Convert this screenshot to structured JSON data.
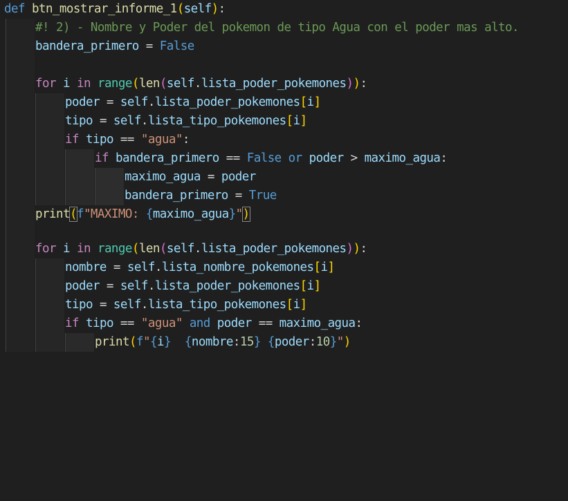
{
  "editor": {
    "lines": [
      {
        "tokens": [
          [
            "kw",
            "def"
          ],
          [
            "pl",
            " "
          ],
          [
            "fn",
            "btn_mostrar_informe_1"
          ],
          [
            "y",
            "("
          ],
          [
            "var",
            "self"
          ],
          [
            "y",
            ")"
          ],
          [
            "pl",
            ":"
          ]
        ]
      },
      {
        "tokens": [
          [
            "cm",
            "#! 2) - Nombre y Poder del pokemon de tipo Agua con el poder mas alto."
          ]
        ]
      },
      {
        "tokens": [
          [
            "var",
            "bandera_primero"
          ],
          [
            "pl",
            " = "
          ],
          [
            "kw",
            "False"
          ]
        ]
      },
      {
        "tokens": []
      },
      {
        "tokens": [
          [
            "ctl",
            "for"
          ],
          [
            "pl",
            " "
          ],
          [
            "var",
            "i"
          ],
          [
            "pl",
            " "
          ],
          [
            "ctl",
            "in"
          ],
          [
            "pl",
            " "
          ],
          [
            "bi",
            "range"
          ],
          [
            "y",
            "("
          ],
          [
            "fn",
            "len"
          ],
          [
            "m",
            "("
          ],
          [
            "var",
            "self"
          ],
          [
            "pl",
            "."
          ],
          [
            "var",
            "lista_poder_pokemones"
          ],
          [
            "m",
            ")"
          ],
          [
            "y",
            ")"
          ],
          [
            "pl",
            ":"
          ]
        ]
      },
      {
        "tokens": [
          [
            "var",
            "poder"
          ],
          [
            "pl",
            " = "
          ],
          [
            "var",
            "self"
          ],
          [
            "pl",
            "."
          ],
          [
            "var",
            "lista_poder_pokemones"
          ],
          [
            "y",
            "["
          ],
          [
            "var",
            "i"
          ],
          [
            "y",
            "]"
          ]
        ]
      },
      {
        "tokens": [
          [
            "var",
            "tipo"
          ],
          [
            "pl",
            " = "
          ],
          [
            "var",
            "self"
          ],
          [
            "pl",
            "."
          ],
          [
            "var",
            "lista_tipo_pokemones"
          ],
          [
            "y",
            "["
          ],
          [
            "var",
            "i"
          ],
          [
            "y",
            "]"
          ]
        ]
      },
      {
        "tokens": [
          [
            "ctl",
            "if"
          ],
          [
            "pl",
            " "
          ],
          [
            "var",
            "tipo"
          ],
          [
            "pl",
            " == "
          ],
          [
            "str",
            "\"agua\""
          ],
          [
            "pl",
            ":"
          ]
        ]
      },
      {
        "tokens": [
          [
            "ctl",
            "if"
          ],
          [
            "pl",
            " "
          ],
          [
            "var",
            "bandera_primero"
          ],
          [
            "pl",
            " == "
          ],
          [
            "kw",
            "False"
          ],
          [
            "pl",
            " "
          ],
          [
            "kw",
            "or"
          ],
          [
            "pl",
            " "
          ],
          [
            "var",
            "poder"
          ],
          [
            "pl",
            " > "
          ],
          [
            "var",
            "maximo_agua"
          ],
          [
            "pl",
            ":"
          ]
        ]
      },
      {
        "tokens": [
          [
            "var",
            "maximo_agua"
          ],
          [
            "pl",
            " = "
          ],
          [
            "var",
            "poder"
          ]
        ]
      },
      {
        "tokens": [
          [
            "var",
            "bandera_primero"
          ],
          [
            "pl",
            " = "
          ],
          [
            "kw",
            "True"
          ]
        ]
      },
      {
        "tokens": [
          [
            "fn",
            "print"
          ],
          [
            "y bm",
            "("
          ],
          [
            "kw",
            "f"
          ],
          [
            "str",
            "\"MAXIMO: "
          ],
          [
            "kw",
            "{"
          ],
          [
            "var",
            "maximo_agua"
          ],
          [
            "kw",
            "}"
          ],
          [
            "str",
            "\""
          ],
          [
            "y bm",
            ")"
          ]
        ]
      },
      {
        "tokens": []
      },
      {
        "tokens": [
          [
            "ctl",
            "for"
          ],
          [
            "pl",
            " "
          ],
          [
            "var",
            "i"
          ],
          [
            "pl",
            " "
          ],
          [
            "ctl",
            "in"
          ],
          [
            "pl",
            " "
          ],
          [
            "bi",
            "range"
          ],
          [
            "y",
            "("
          ],
          [
            "fn",
            "len"
          ],
          [
            "m",
            "("
          ],
          [
            "var",
            "self"
          ],
          [
            "pl",
            "."
          ],
          [
            "var",
            "lista_poder_pokemones"
          ],
          [
            "m",
            ")"
          ],
          [
            "y",
            ")"
          ],
          [
            "pl",
            ":"
          ]
        ]
      },
      {
        "tokens": [
          [
            "var",
            "nombre"
          ],
          [
            "pl",
            " = "
          ],
          [
            "var",
            "self"
          ],
          [
            "pl",
            "."
          ],
          [
            "var",
            "lista_nombre_pokemones"
          ],
          [
            "y",
            "["
          ],
          [
            "var",
            "i"
          ],
          [
            "y",
            "]"
          ]
        ]
      },
      {
        "tokens": [
          [
            "var",
            "poder"
          ],
          [
            "pl",
            " = "
          ],
          [
            "var",
            "self"
          ],
          [
            "pl",
            "."
          ],
          [
            "var",
            "lista_poder_pokemones"
          ],
          [
            "y",
            "["
          ],
          [
            "var",
            "i"
          ],
          [
            "y",
            "]"
          ]
        ]
      },
      {
        "tokens": [
          [
            "var",
            "tipo"
          ],
          [
            "pl",
            " = "
          ],
          [
            "var",
            "self"
          ],
          [
            "pl",
            "."
          ],
          [
            "var",
            "lista_tipo_pokemones"
          ],
          [
            "y",
            "["
          ],
          [
            "var",
            "i"
          ],
          [
            "y",
            "]"
          ]
        ]
      },
      {
        "tokens": [
          [
            "ctl",
            "if"
          ],
          [
            "pl",
            " "
          ],
          [
            "var",
            "tipo"
          ],
          [
            "pl",
            " == "
          ],
          [
            "str",
            "\"agua\""
          ],
          [
            "pl",
            " "
          ],
          [
            "kw",
            "and"
          ],
          [
            "pl",
            " "
          ],
          [
            "var",
            "poder"
          ],
          [
            "pl",
            " == "
          ],
          [
            "var",
            "maximo_agua"
          ],
          [
            "pl",
            ":"
          ]
        ]
      },
      {
        "tokens": [
          [
            "fn",
            "print"
          ],
          [
            "y",
            "("
          ],
          [
            "kw",
            "f"
          ],
          [
            "str",
            "\""
          ],
          [
            "kw",
            "{"
          ],
          [
            "var",
            "i"
          ],
          [
            "kw",
            "}"
          ],
          [
            "str",
            "  "
          ],
          [
            "kw",
            "{"
          ],
          [
            "var",
            "nombre"
          ],
          [
            "pl",
            ":"
          ],
          [
            "num",
            "15"
          ],
          [
            "kw",
            "}"
          ],
          [
            "pl",
            " "
          ],
          [
            "kw",
            "{"
          ],
          [
            "var",
            "poder"
          ],
          [
            "pl",
            ":"
          ],
          [
            "num",
            "10"
          ],
          [
            "kw",
            "}"
          ],
          [
            "str",
            "\""
          ],
          [
            "y",
            ")"
          ]
        ]
      }
    ]
  }
}
